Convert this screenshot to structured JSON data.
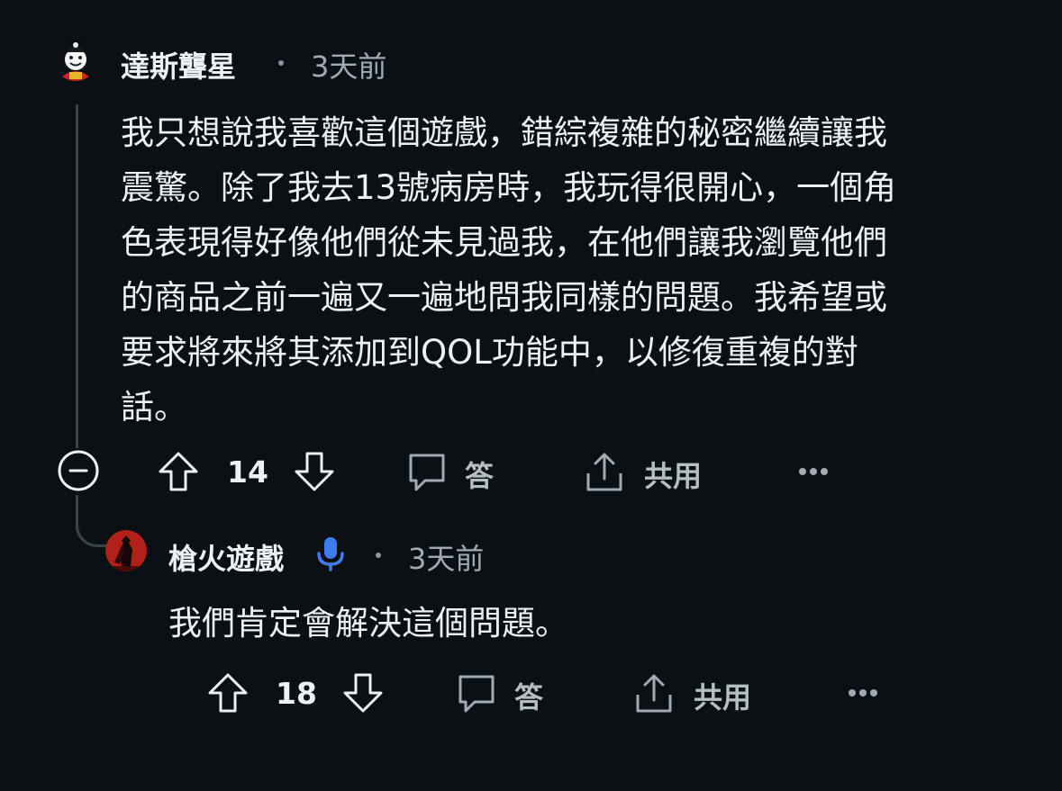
{
  "comment": {
    "username": "達斯聾星",
    "time": "3天前",
    "body_lines": [
      "我只想說我喜歡這個遊戲，錯綜複雜的秘密繼續讓我",
      "震驚。除了我去13號病房時，我玩得很開心，一個角",
      "色表現得好像他們從未見過我，在他們讓我瀏覽他們",
      "的商品之前一遍又一遍地問我同樣的問題。我希望或",
      "要求將來將其添加到QOL功能中，以修復重複的對",
      "話。"
    ],
    "vote_count": "14",
    "reply_label": "答",
    "share_label": "共用"
  },
  "reply": {
    "username": "槍火遊戲",
    "time": "3天前",
    "body": "我們肯定會解決這個問題。",
    "vote_count": "18",
    "reply_label": "答",
    "share_label": "共用"
  },
  "icons": {
    "collapse": "minus-circle-icon",
    "upvote": "arrow-up-icon",
    "downvote": "arrow-down-icon",
    "reply": "speech-bubble-icon",
    "share": "share-icon",
    "more": "ellipsis-icon",
    "badge": "microphone-icon"
  },
  "colors": {
    "background": "#0b1014",
    "text": "#eef1f3",
    "muted": "#a2abb0",
    "badge": "#3f7cf0"
  }
}
